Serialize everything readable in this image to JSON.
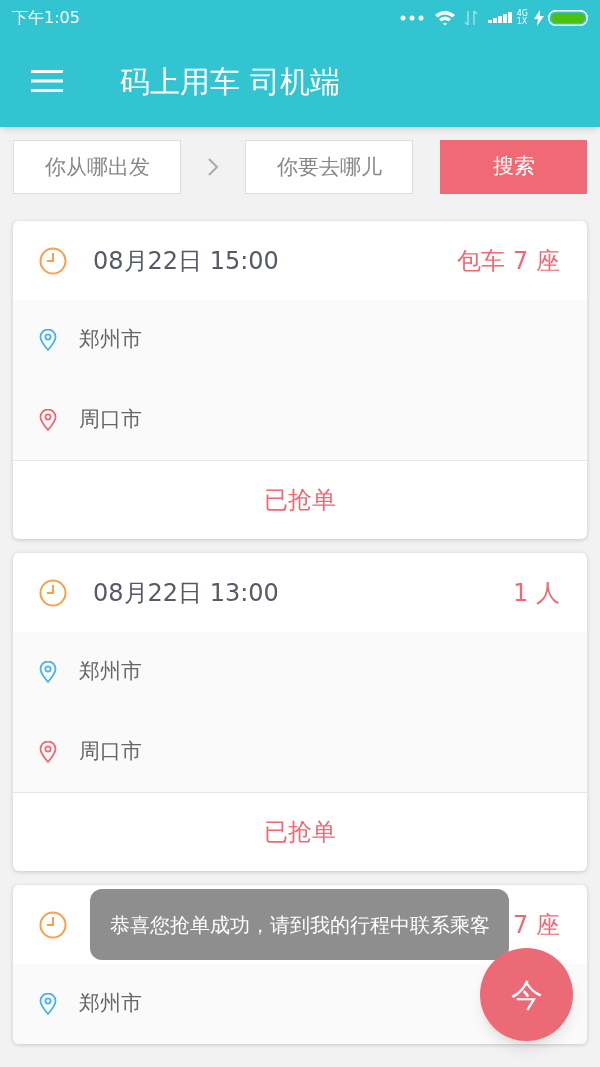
{
  "status_bar": {
    "time": "下午1:05",
    "network_top": "4G",
    "network_bottom": "1X"
  },
  "app_bar": {
    "title": "码上用车 司机端"
  },
  "search": {
    "from_placeholder": "你从哪出发",
    "to_placeholder": "你要去哪儿",
    "button": "搜索"
  },
  "orders": [
    {
      "time": "08月22日 15:00",
      "tag": "包车 7 座",
      "from": "郑州市",
      "to": "周口市",
      "status": "已抢单"
    },
    {
      "time": "08月22日 13:00",
      "tag": "1 人",
      "from": "郑州市",
      "to": "周口市",
      "status": "已抢单"
    },
    {
      "tag": "7 座",
      "from": "郑州市"
    }
  ],
  "toast": "恭喜您抢单成功，请到我的行程中联系乘客",
  "fab": {
    "label": "今"
  }
}
